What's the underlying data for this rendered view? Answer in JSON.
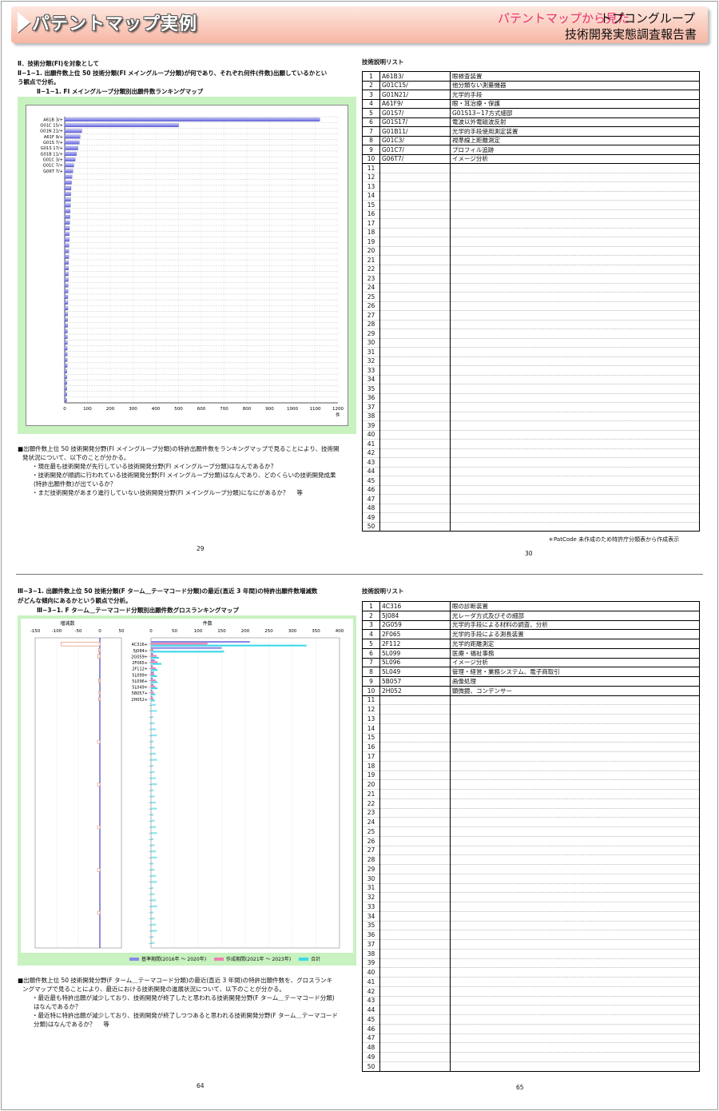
{
  "header": {
    "title": "パテントマップ実例",
    "right_pink": "パテントマップから見た",
    "right_black": "トプコングループ",
    "report": "技術開発実態調査報告書"
  },
  "top": {
    "heading": "Ⅱ．技術分類(FI)を対象として",
    "question_l1": "Ⅱ−1−1. 出願件数上位 50 技術分類(FI メイングループ分類)が何であり、それぞれ何件(件数)出願しているかとい",
    "question_l2": "う観点で分析。",
    "chart_title": "Ⅱ−1−1. FI メイングループ分類別出願件数ランキングマップ",
    "list_title": "技術説明リスト",
    "notes": [
      "■出願件数上位 50 技術開発分野(FI メイングループ分類)の特許出願件数をランキングマップで見ることにより、技術開",
      "発状況について、以下のことが分かる。",
      "・現在最も技術開発が先行している技術開発分野(FI メイングループ分類)はなんであるか？",
      "・技術開発が順調に行われている技術開発分野(FI メイングループ分類)はなんであり、どのくらいの技術開発成果",
      "(特許出願件数)が出ているか？",
      "・まだ技術開発があまり進行していない技術開発分野(FI メイングループ分類)になにがあるか？　 等"
    ],
    "footnote": "＊PatCode 未作成のため特許庁分類表から作成表示",
    "page_left": "29",
    "page_right": "30",
    "x_unit": "件",
    "list": [
      [
        "1",
        "A61B3/",
        "眼検査装置"
      ],
      [
        "2",
        "G01C15/",
        "他分類ない測量機器"
      ],
      [
        "3",
        "G01N21/",
        "光学的手段"
      ],
      [
        "4",
        "A61F9/",
        "眼・耳治療・保護"
      ],
      [
        "5",
        "G01S7/",
        "G01S13−17方式細部"
      ],
      [
        "6",
        "G01S17/",
        "電波以外電磁波反射"
      ],
      [
        "7",
        "G01B11/",
        "光学的手段使用測定装置"
      ],
      [
        "8",
        "G01C3/",
        "視準線上距離測定"
      ],
      [
        "9",
        "G01C7/",
        "プロフィル追跡"
      ],
      [
        "10",
        "G06T7/",
        "イメージ分析"
      ]
    ]
  },
  "bottom": {
    "question_l1": "Ⅲ−3−1. 出願件数上位 50 技術分類(F ターム＿テーマコード分類)の最近(直近 3 年間)の特許出願件数増減数",
    "question_l2": "がどんな傾向にあるかという観点で分析。",
    "chart_title": "Ⅲ−3−1. F ターム＿テーマコード分類別出願件数グロスランキングマップ",
    "list_title": "技術説明リスト",
    "left_axis_label": "増減数",
    "right_axis_label": "件数",
    "legend": [
      "基準期間(2016年 〜 2020年)",
      "作成期間(2021年 〜 2023年)",
      "合計"
    ],
    "notes": [
      "■出願件数上位 50 技術開発分野(F ターム＿テーマコード分類)の最近(直近 3 年間)の特許出願件数を、グロスランキ",
      "ングマップで見ることにより、最近における技術開発の進展状況について、以下のことが分かる。",
      "・最近最も特許出願が減少しており、技術開発が終了したと思われる技術開発分野(F ターム＿テーマコード分類)",
      "はなんであるか？",
      "・最近特に特許出願が減少しており、技術開発が終了しつつあると思われる技術開発分野(F ターム＿テーマコード",
      "分類)はなんであるか？　 等"
    ],
    "page_left": "64",
    "page_right": "65",
    "list": [
      [
        "1",
        "4C316",
        "眼の診断装置"
      ],
      [
        "2",
        "5J084",
        "光レーダ方式及びその細部"
      ],
      [
        "3",
        "2G059",
        "光学的手段による材料の調査、分析"
      ],
      [
        "4",
        "2F065",
        "光学的手段による測長装置"
      ],
      [
        "5",
        "2F112",
        "光学的距離測定"
      ],
      [
        "6",
        "5L099",
        "医療・福祉事務"
      ],
      [
        "7",
        "5L096",
        "イメージ分析"
      ],
      [
        "8",
        "5L049",
        "管理・経営・業務システム、電子商取引"
      ],
      [
        "9",
        "5B057",
        "画像処理"
      ],
      [
        "10",
        "2H052",
        "顕微鏡、コンデンサー"
      ]
    ]
  },
  "chart_data": [
    {
      "type": "bar",
      "orientation": "horizontal",
      "categories": [
        "A61B 3/+",
        "G01C 15/+",
        "G01N 21/+",
        "A61F 9/+",
        "G01S 7/+",
        "G01S 17/+",
        "G01B 11/+",
        "G01C 3/+",
        "G01C 7/+",
        "G06T 7/+"
      ],
      "values": [
        1120,
        500,
        75,
        68,
        64,
        58,
        52,
        46,
        40,
        36
      ],
      "tail_values": [
        32,
        30,
        28,
        27,
        26,
        25,
        24,
        23,
        22,
        21,
        20,
        20,
        19,
        18,
        18,
        17,
        17,
        16,
        16,
        15,
        15,
        14,
        14,
        14,
        13,
        13,
        13,
        12,
        12,
        12,
        11,
        11,
        11,
        11,
        10,
        10,
        10,
        10,
        10,
        9
      ],
      "xlabel": "件",
      "xlim": [
        0,
        1200
      ],
      "xticks": [
        0,
        100,
        200,
        300,
        400,
        500,
        600,
        700,
        800,
        900,
        1000,
        1100,
        1200
      ]
    },
    {
      "type": "bar",
      "orientation": "horizontal",
      "categories": [
        "4C316+",
        "5J084+",
        "2G059+",
        "2F065+",
        "2F112+",
        "5L099+",
        "5L096+",
        "5L049+",
        "5B057+",
        "2H052+"
      ],
      "series": [
        {
          "name": "基準期間(2016年 〜 2020年)",
          "values": [
            210,
            150,
            5,
            8,
            4,
            6,
            4,
            5,
            3,
            3
          ]
        },
        {
          "name": "作成期間(2021年 〜 2023年)",
          "values": [
            120,
            5,
            12,
            14,
            10,
            7,
            10,
            9,
            6,
            5
          ]
        },
        {
          "name": "合計",
          "values": [
            330,
            155,
            17,
            22,
            14,
            13,
            14,
            14,
            9,
            8
          ]
        }
      ],
      "change": [
        -90,
        -3,
        -5,
        0,
        0,
        0,
        -3,
        0,
        -2,
        -3
      ],
      "left_xlim": [
        -150,
        50
      ],
      "left_xticks": [
        -150,
        -100,
        -50,
        0,
        50
      ],
      "right_xlim": [
        0,
        400
      ],
      "right_xticks": [
        0,
        50,
        100,
        150,
        200,
        250,
        300,
        350,
        400
      ],
      "colors": {
        "base": "#8a8ae6",
        "recent": "#f07fb0",
        "total": "#3fd8e8"
      }
    }
  ]
}
